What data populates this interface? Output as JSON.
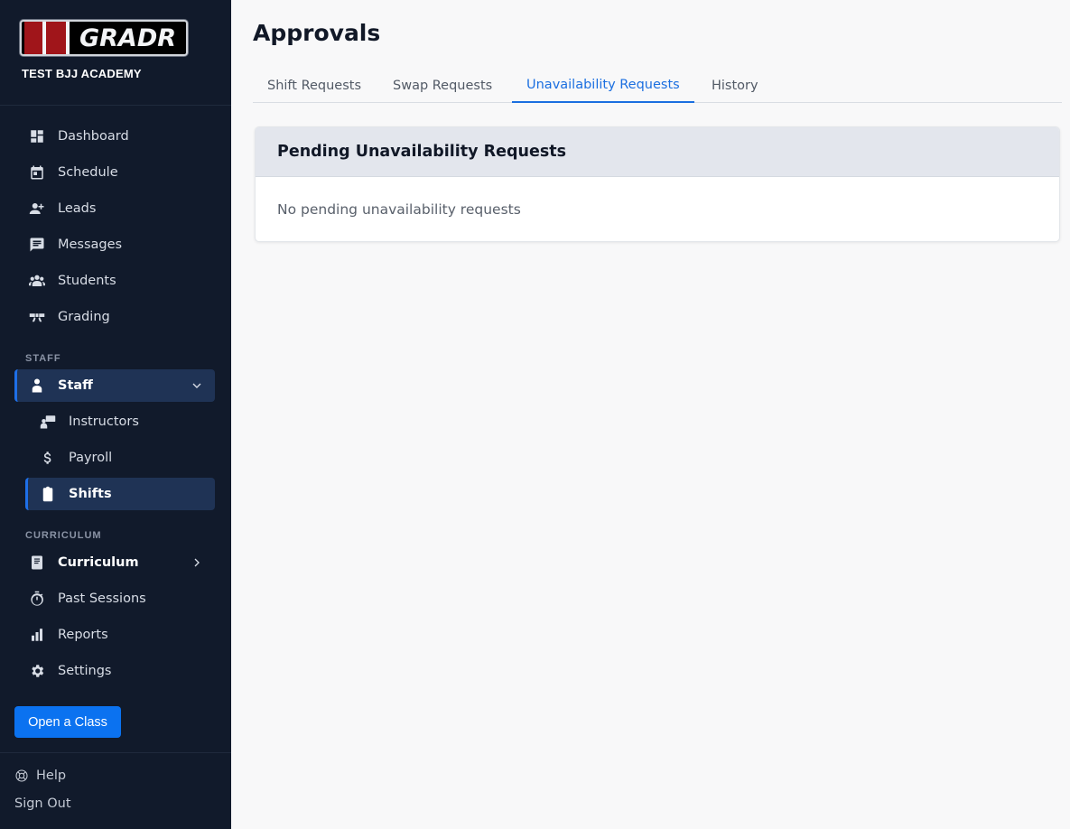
{
  "brand": {
    "logo_text": "GRADR",
    "academy_name": "TEST BJJ ACADEMY"
  },
  "nav": {
    "main": [
      {
        "label": "Dashboard",
        "icon": "dashboard-icon"
      },
      {
        "label": "Schedule",
        "icon": "calendar-icon"
      },
      {
        "label": "Leads",
        "icon": "person-add-icon"
      },
      {
        "label": "Messages",
        "icon": "chat-icon"
      },
      {
        "label": "Students",
        "icon": "group-icon"
      },
      {
        "label": "Grading",
        "icon": "belt-icon"
      }
    ],
    "staff_section_label": "STAFF",
    "staff": {
      "label": "Staff",
      "icon": "person-icon"
    },
    "staff_sub": [
      {
        "label": "Instructors",
        "icon": "instructor-icon"
      },
      {
        "label": "Payroll",
        "icon": "dollar-icon"
      },
      {
        "label": "Shifts",
        "icon": "clipboard-icon"
      }
    ],
    "curriculum_section_label": "CURRICULUM",
    "curriculum": {
      "label": "Curriculum",
      "icon": "book-icon"
    },
    "more": [
      {
        "label": "Past Sessions",
        "icon": "timer-icon"
      },
      {
        "label": "Reports",
        "icon": "bar-chart-icon"
      },
      {
        "label": "Settings",
        "icon": "gear-icon"
      }
    ],
    "open_class_label": "Open a Class",
    "help_label": "Help",
    "sign_out_label": "Sign Out"
  },
  "main": {
    "title": "Approvals",
    "tabs": [
      {
        "label": "Shift Requests"
      },
      {
        "label": "Swap Requests"
      },
      {
        "label": "Unavailability Requests",
        "active": true
      },
      {
        "label": "History"
      }
    ],
    "card": {
      "title": "Pending Unavailability Requests",
      "empty_text": "No pending unavailability requests"
    }
  },
  "colors": {
    "sidebar_bg": "#111a2b",
    "accent": "#1e6fe8",
    "button": "#0b72f0",
    "active_bg": "#1f3355"
  }
}
